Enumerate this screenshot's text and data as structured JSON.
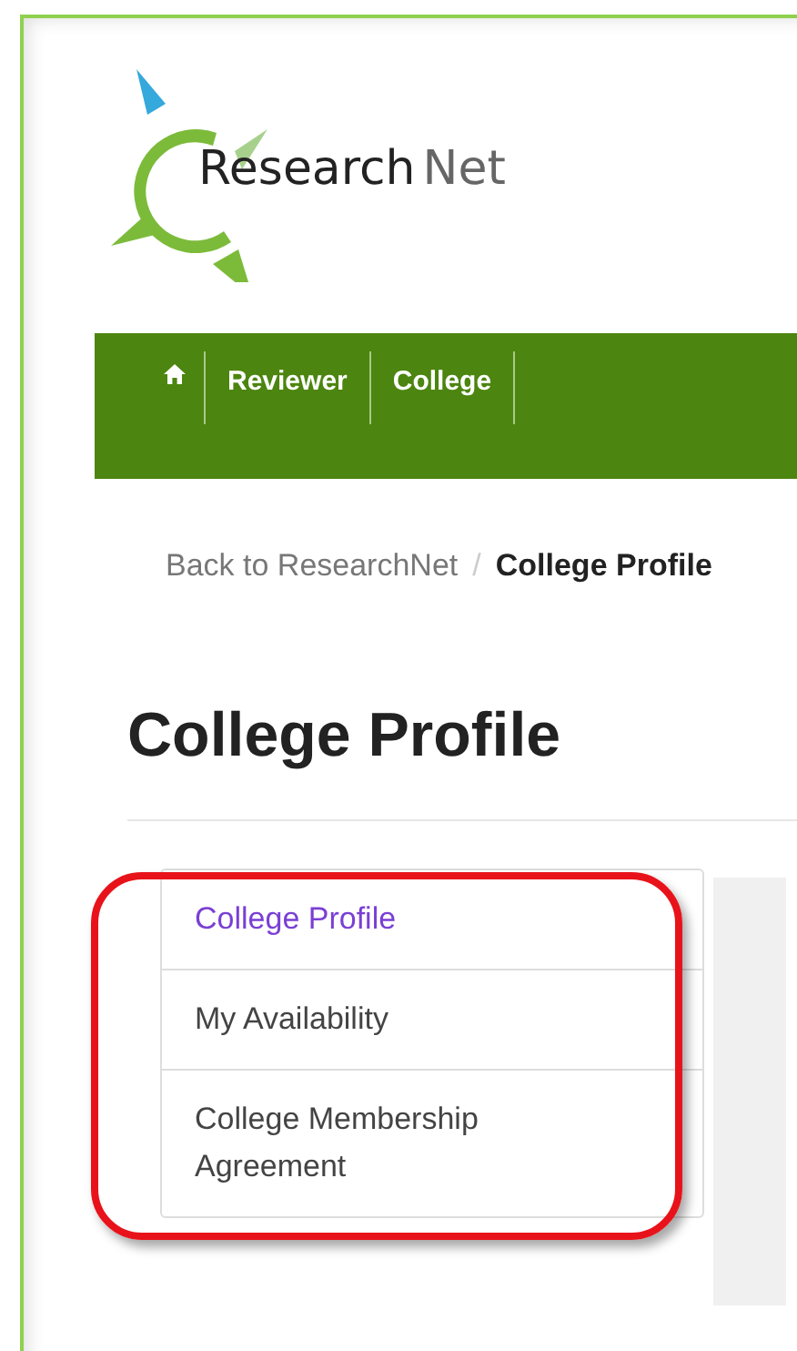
{
  "logo": {
    "word_1": "Research",
    "word_2": "Net"
  },
  "nav": {
    "items": [
      {
        "kind": "home"
      },
      {
        "kind": "text",
        "label": "Reviewer"
      },
      {
        "kind": "text",
        "label": "College"
      }
    ]
  },
  "breadcrumb": {
    "link": "Back to ResearchNet",
    "separator": "/",
    "current": "College Profile"
  },
  "heading": "College Profile",
  "side_menu": {
    "highlighted": true,
    "items": [
      {
        "label": "College Profile",
        "selected": true
      },
      {
        "label": "My Availability",
        "selected": false
      },
      {
        "label": "College Membership Agreement",
        "selected": false
      }
    ]
  }
}
